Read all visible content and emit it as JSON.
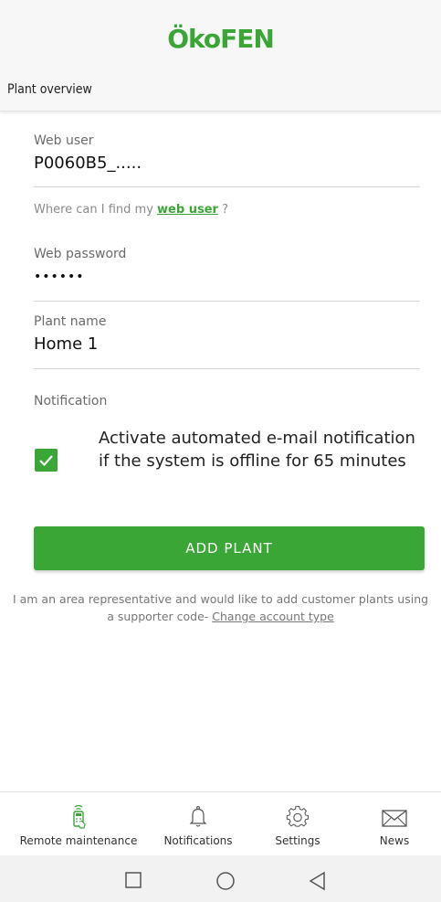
{
  "header": {
    "logo": "ÖkoFEN",
    "title": "Plant overview"
  },
  "form": {
    "web_user": {
      "label": "Web user",
      "value": "P0060B5_....."
    },
    "help": {
      "prefix": "Where can I find my ",
      "link": "web user",
      "suffix": " ?"
    },
    "web_password": {
      "label": "Web password",
      "value": "••••••"
    },
    "plant_name": {
      "label": "Plant name",
      "value": "Home 1"
    },
    "notification": {
      "label": "Notification",
      "checkbox_text": "Activate automated e-mail notification if the system is offline for 65 minutes",
      "checked": true
    },
    "add_button": "ADD PLANT",
    "rep_line1": "I am an area representative and would like to add customer plants using",
    "rep_line2_prefix": "a supporter code- ",
    "rep_link": "Change account type"
  },
  "bottom_nav": {
    "items": [
      {
        "label": "Remote maintenance",
        "icon": "remote-icon"
      },
      {
        "label": "Notifications",
        "icon": "bell-icon"
      },
      {
        "label": "Settings",
        "icon": "gear-icon"
      },
      {
        "label": "News",
        "icon": "mail-icon"
      }
    ]
  },
  "system_bar": {
    "buttons": [
      "recent-apps-icon",
      "home-icon",
      "back-icon"
    ]
  },
  "colors": {
    "accent": "#3aa635",
    "header_bg": "#f7f7f7",
    "system_bar_bg": "#f2f2f2"
  }
}
